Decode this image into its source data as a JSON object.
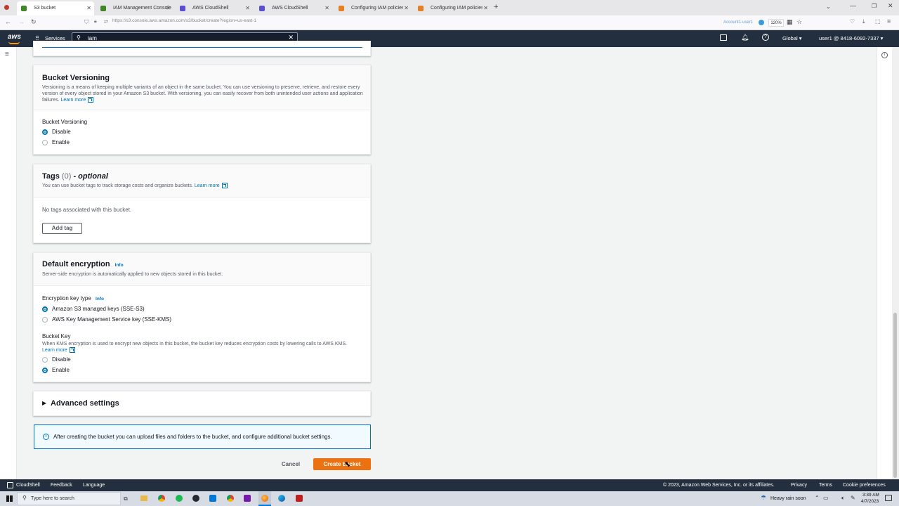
{
  "browser": {
    "tabs": [
      {
        "label": "S3 bucket",
        "color": "#3f8624"
      },
      {
        "label": "IAM Management Console",
        "color": "#3f8624"
      },
      {
        "label": "AWS CloudShell",
        "color": "#5a4fcf"
      },
      {
        "label": "AWS CloudShell",
        "color": "#5a4fcf"
      },
      {
        "label": "Configuring IAM policies for us",
        "color": "#e67e22"
      },
      {
        "label": "Configuring IAM policies for us",
        "color": "#e67e22"
      }
    ],
    "url": "https://s3.console.aws.amazon.com/s3/bucket/create?region=us-east-1",
    "account_badge": "Account1-user1",
    "zoom": "120%"
  },
  "aws_nav": {
    "logo": "aws",
    "services": "Services",
    "search_value": "iam",
    "region": "Global",
    "user": "user1 @ 8418-6092-7337"
  },
  "versioning": {
    "title": "Bucket Versioning",
    "description": "Versioning is a means of keeping multiple variants of an object in the same bucket. You can use versioning to preserve, retrieve, and restore every version of every object stored in your Amazon S3 bucket. With versioning, you can easily recover from both unintended user actions and application failures.",
    "learn_more": "Learn more",
    "field_label": "Bucket Versioning",
    "options": [
      "Disable",
      "Enable"
    ],
    "selected": "Disable"
  },
  "tags": {
    "title": "Tags",
    "count": "(0)",
    "optional": "- optional",
    "description": "You can use bucket tags to track storage costs and organize buckets.",
    "learn_more": "Learn more",
    "empty": "No tags associated with this bucket.",
    "add_button": "Add tag"
  },
  "encryption": {
    "title": "Default encryption",
    "info": "Info",
    "description": "Server-side encryption is automatically applied to new objects stored in this bucket.",
    "key_type_label": "Encryption key type",
    "key_type_info": "Info",
    "key_options": [
      "Amazon S3 managed keys (SSE-S3)",
      "AWS Key Management Service key (SSE-KMS)"
    ],
    "bucket_key_label": "Bucket Key",
    "bucket_key_desc": "When KMS encryption is used to encrypt new objects in this bucket, the bucket key reduces encryption costs by lowering calls to AWS KMS.",
    "learn_more": "Learn more",
    "bucket_key_options": [
      "Disable",
      "Enable"
    ]
  },
  "advanced": {
    "title": "Advanced settings"
  },
  "notice": {
    "text": "After creating the bucket you can upload files and folders to the bucket, and configure additional bucket settings."
  },
  "actions": {
    "cancel": "Cancel",
    "create": "Create bucket"
  },
  "footer": {
    "cloudshell": "CloudShell",
    "feedback": "Feedback",
    "language": "Language",
    "copyright": "© 2023, Amazon Web Services, Inc. or its affiliates.",
    "privacy": "Privacy",
    "terms": "Terms",
    "cookies": "Cookie preferences"
  },
  "taskbar": {
    "search_placeholder": "Type here to search",
    "weather": "Heavy rain soon",
    "time": "3:39 AM",
    "date": "4/7/2023"
  }
}
